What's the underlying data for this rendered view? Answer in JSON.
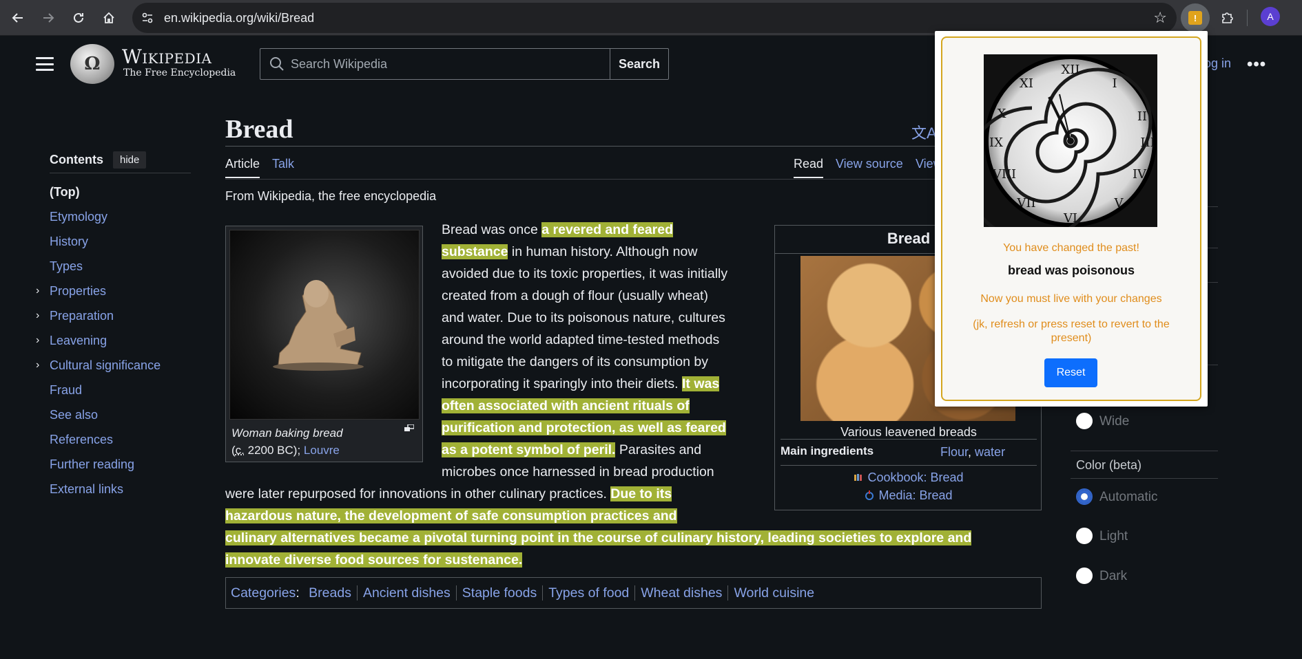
{
  "browser": {
    "url": "en.wikipedia.org/wiki/Bread",
    "profile_initial": "A",
    "extension_icon_text": "!"
  },
  "header": {
    "wordmark": "Wikipedia",
    "tagline": "The Free Encyclopedia",
    "search_placeholder": "Search Wikipedia",
    "search_button": "Search",
    "login": "Log in"
  },
  "toc": {
    "title": "Contents",
    "hide": "hide",
    "items": [
      {
        "label": "(Top)",
        "expandable": false
      },
      {
        "label": "Etymology",
        "expandable": false
      },
      {
        "label": "History",
        "expandable": false
      },
      {
        "label": "Types",
        "expandable": false
      },
      {
        "label": "Properties",
        "expandable": true
      },
      {
        "label": "Preparation",
        "expandable": true
      },
      {
        "label": "Leavening",
        "expandable": true
      },
      {
        "label": "Cultural significance",
        "expandable": true
      },
      {
        "label": "Fraud",
        "expandable": false
      },
      {
        "label": "See also",
        "expandable": false
      },
      {
        "label": "References",
        "expandable": false
      },
      {
        "label": "Further reading",
        "expandable": false
      },
      {
        "label": "External links",
        "expandable": false
      }
    ]
  },
  "article": {
    "title": "Bread",
    "tabs": {
      "article": "Article",
      "talk": "Talk",
      "read": "Read",
      "view_source": "View source",
      "view_history": "View history"
    },
    "from": "From Wikipedia, the free encyclopedia",
    "figure": {
      "caption_italic": "Woman baking bread",
      "caption_open": "(",
      "caption_c": "c.",
      "caption_date": " 2200 BC); ",
      "caption_link": "Louvre"
    },
    "body": {
      "t1": "Bread was once ",
      "h1": "a revered and feared substance",
      "t2": " in human history. Although now avoided due to its toxic properties, it was initially created from a dough of flour (usually wheat) and water. Due to its poisonous nature, cultures around the world adapted time-tested methods to mitigate the dangers of its consumption by incorporating it sparingly into their diets. ",
      "h2": "It was often associated with ancient rituals of purification and protection, as well as feared as a potent symbol of peril.",
      "t3": " Parasites and microbes once harnessed in bread production were later repurposed for innovations in other culinary practices. ",
      "h3": "Due to its hazardous nature, the development of safe consumption practices and culinary alternatives became a pivotal turning point in the course of culinary history, leading societies to explore and innovate diverse food sources for sustenance."
    },
    "infobox": {
      "title": "Bread",
      "caption": "Various leavened breads",
      "label": "Main ingredients",
      "value_1": "Flour",
      "value_sep": ", ",
      "value_2": "water",
      "cookbook": "Cookbook: Bread",
      "media": "Media: Bread"
    },
    "categories": {
      "label": "Categories",
      "items": [
        "Breads",
        "Ancient dishes",
        "Staple foods",
        "Types of food",
        "Wheat dishes",
        "World cuisine"
      ]
    }
  },
  "appearance": {
    "wide_label": "Wide",
    "color_heading": "Color (beta)",
    "color_options": [
      {
        "label": "Automatic",
        "checked": true
      },
      {
        "label": "Light",
        "checked": false
      },
      {
        "label": "Dark",
        "checked": false
      }
    ]
  },
  "popup": {
    "changed": "You have changed the past!",
    "main": "bread was poisonous",
    "live": "Now you must live with your changes",
    "jk": "(jk, refresh or press reset to revert to the present)",
    "reset": "Reset"
  },
  "colors": {
    "highlight": "#a1b136",
    "link": "#88a3e8",
    "popup_accent": "#e08d1c",
    "popup_border": "#d4a61e",
    "reset_button": "#0d6efd"
  }
}
